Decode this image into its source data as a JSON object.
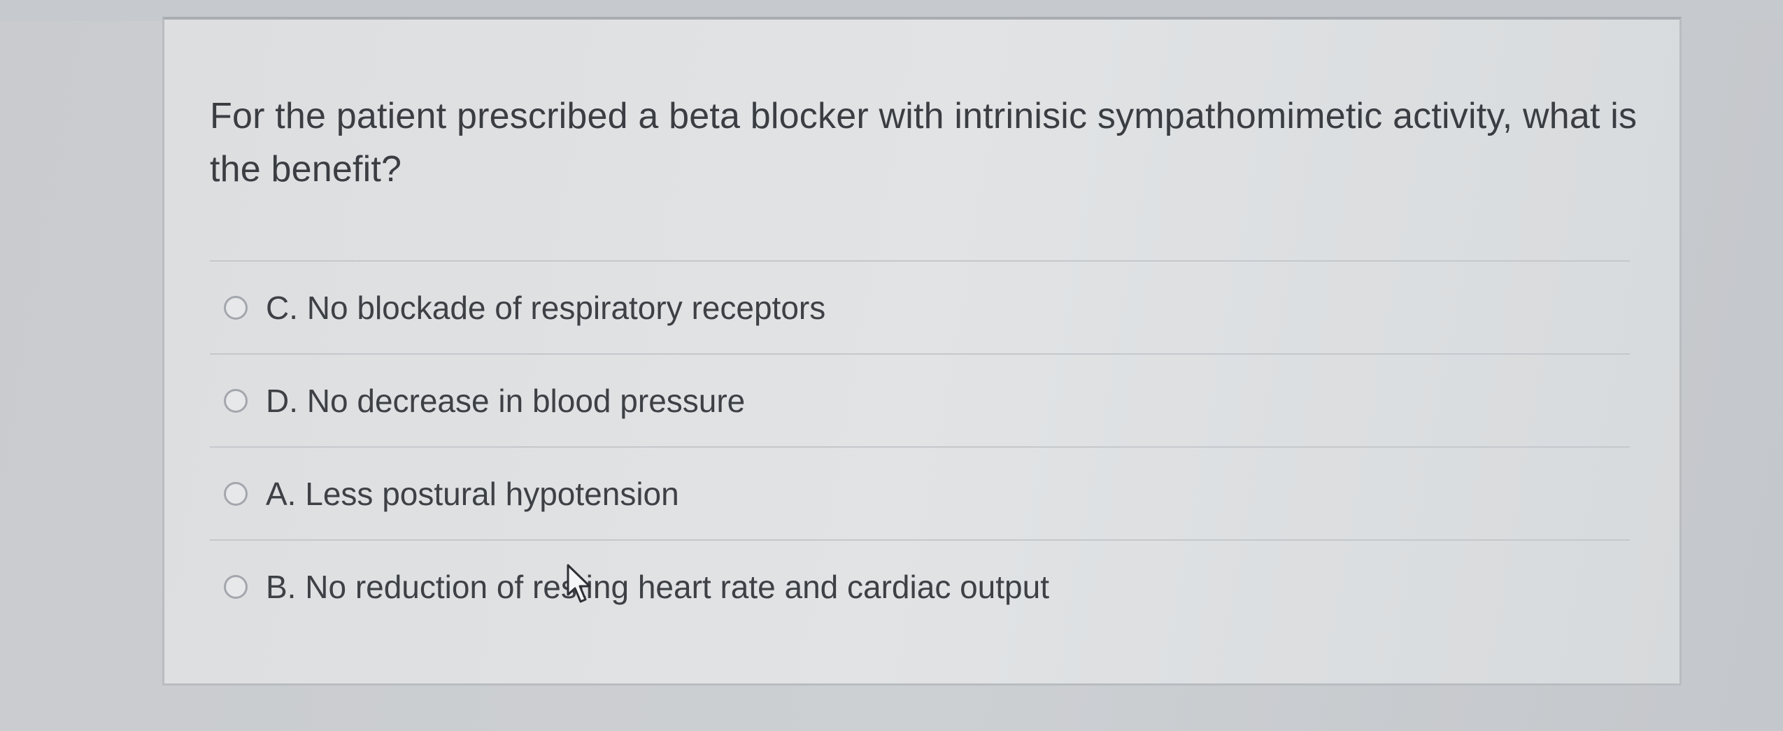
{
  "question": {
    "text": "For the patient prescribed a beta blocker with intrinisic sympathomimetic activity, what is the benefit?"
  },
  "options": [
    {
      "label": "C. No blockade of respiratory receptors",
      "selected": false
    },
    {
      "label": "D. No decrease in blood pressure",
      "selected": false
    },
    {
      "label": "A. Less postural hypotension",
      "selected": false
    },
    {
      "label": "B. No reduction of resting heart rate and cardiac output",
      "selected": false
    }
  ],
  "icons": {
    "radio": "radio-unselected-icon",
    "cursor": "mouse-pointer-icon"
  },
  "colors": {
    "page_background": "#cbced2",
    "card_background": "#dfe1e3",
    "text": "#3a3d42",
    "radio_border": "#a3a7ad"
  }
}
